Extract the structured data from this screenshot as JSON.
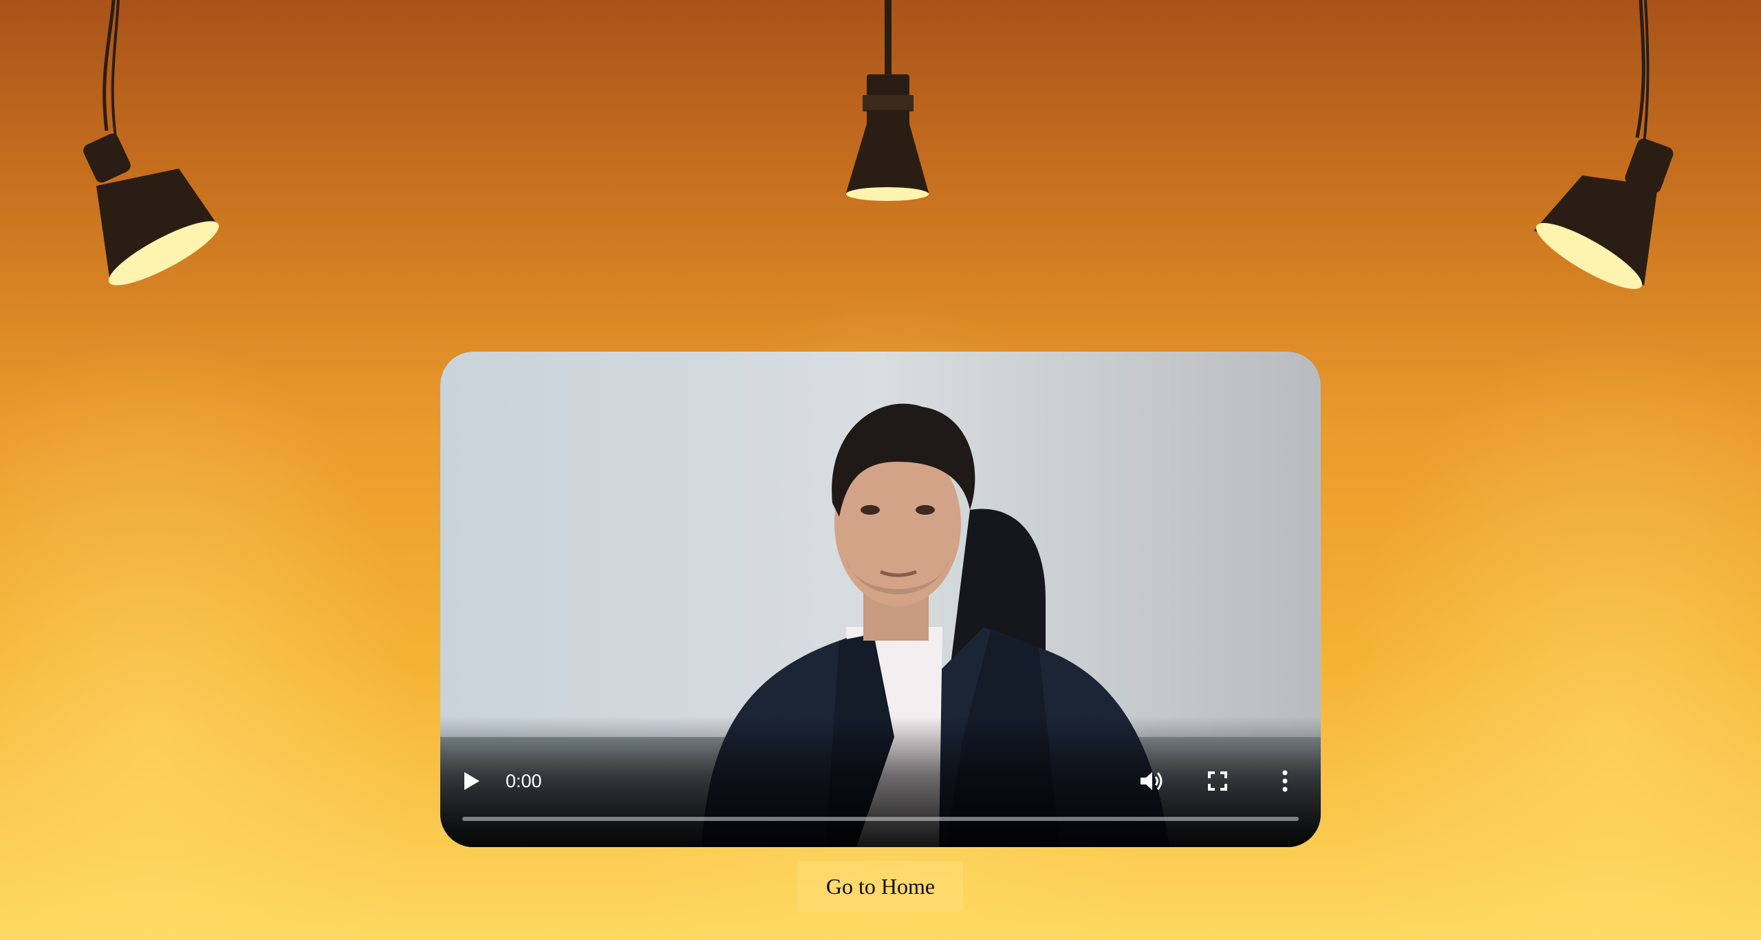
{
  "video": {
    "current_time": "0:00",
    "progress_fraction": 0,
    "icons": {
      "play": "play-icon",
      "volume": "volume-icon",
      "fullscreen": "fullscreen-icon",
      "more": "more-options-icon"
    }
  },
  "navigation": {
    "home_button_label": "Go to Home"
  },
  "colors": {
    "background_top": "#a9531a",
    "background_bottom": "#fed85f",
    "lamp_shade": "#2a1e14",
    "lamp_bulb": "#fff3b0"
  }
}
